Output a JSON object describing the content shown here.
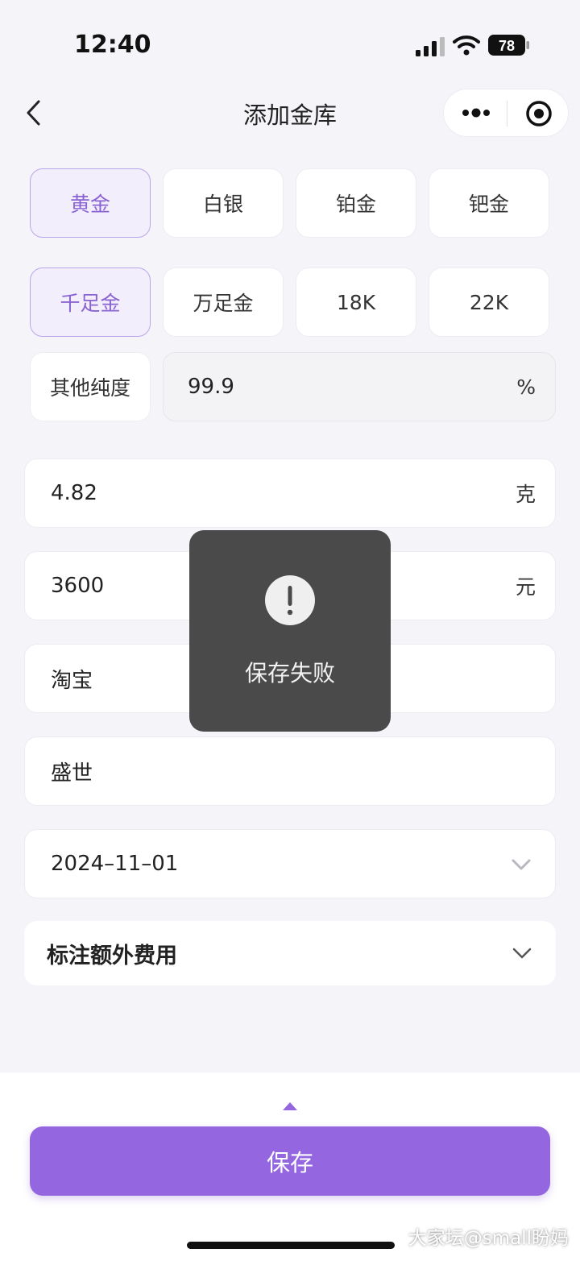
{
  "status_bar": {
    "time": "12:40",
    "battery": "78"
  },
  "nav": {
    "title": "添加金库"
  },
  "metal_types": [
    "黄金",
    "白银",
    "铂金",
    "钯金"
  ],
  "purity_options": [
    "千足金",
    "万足金",
    "18K",
    "22K"
  ],
  "other_purity": {
    "label": "其他纯度",
    "value": "99.9",
    "unit": "%"
  },
  "weight": {
    "value": "4.82",
    "unit": "克"
  },
  "price": {
    "value": "3600",
    "unit": "元"
  },
  "source": {
    "value": "淘宝"
  },
  "brand": {
    "value": "盛世"
  },
  "date": {
    "value": "2024–11–01"
  },
  "extra_fee": {
    "label": "标注额外费用"
  },
  "save_button": {
    "label": "保存"
  },
  "toast": {
    "message": "保存失败"
  },
  "watermark": "大家坛@small盼妈",
  "colors": {
    "accent": "#9467e0",
    "chip_active_bg": "#f3eefc",
    "toast_bg": "#4a4a4a"
  }
}
